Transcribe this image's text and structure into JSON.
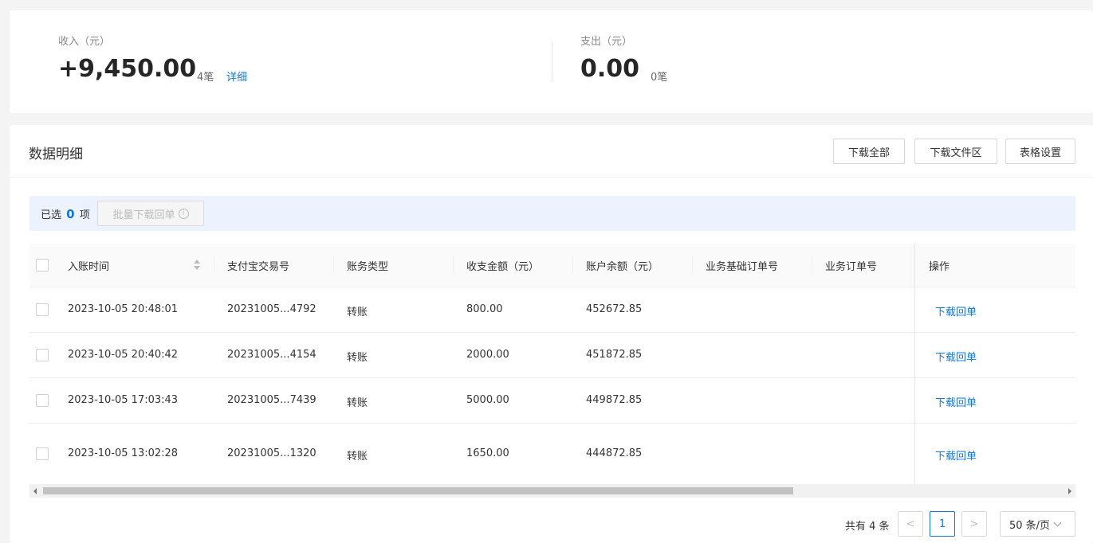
{
  "summary": {
    "income": {
      "label": "收入（元）",
      "amount": "+9,450.00",
      "count": "4笔",
      "detail_link": "详细"
    },
    "expense": {
      "label": "支出（元）",
      "amount": "0.00",
      "count": "0笔"
    }
  },
  "detail": {
    "title": "数据明细",
    "buttons": {
      "download_all": "下载全部",
      "download_files": "下载文件区",
      "table_settings": "表格设置"
    },
    "selection": {
      "prefix": "已选",
      "count": "0",
      "suffix": "项",
      "batch_button": "批量下载回单"
    },
    "columns": [
      "入账时间",
      "支付宝交易号",
      "账务类型",
      "收支金额（元）",
      "账户余额（元）",
      "业务基础订单号",
      "业务订单号",
      "操作"
    ],
    "rows": [
      {
        "time": "2023-10-05 20:48:01",
        "trade_no": "20231005...4792",
        "type": "转账",
        "amount": "800.00",
        "balance": "452672.85",
        "action": "下载回单"
      },
      {
        "time": "2023-10-05 20:40:42",
        "trade_no": "20231005...4154",
        "type": "转账",
        "amount": "2000.00",
        "balance": "451872.85",
        "action": "下载回单"
      },
      {
        "time": "2023-10-05 17:03:43",
        "trade_no": "20231005...7439",
        "type": "转账",
        "amount": "5000.00",
        "balance": "449872.85",
        "action": "下载回单"
      },
      {
        "time": "2023-10-05 13:02:28",
        "trade_no": "20231005...1320",
        "type": "转账",
        "amount": "1650.00",
        "balance": "444872.85",
        "action": "下载回单"
      }
    ],
    "pagination": {
      "total_text": "共有 4 条",
      "prev": "<",
      "current": "1",
      "next": ">",
      "page_size": "50 条/页"
    }
  },
  "colors": {
    "accent": "#1677d2",
    "select_bar_bg": "#ecf3ff"
  },
  "icons": [
    "info-icon",
    "sort-icon",
    "chevron-down-icon",
    "chevron-left-icon",
    "chevron-right-icon"
  ]
}
